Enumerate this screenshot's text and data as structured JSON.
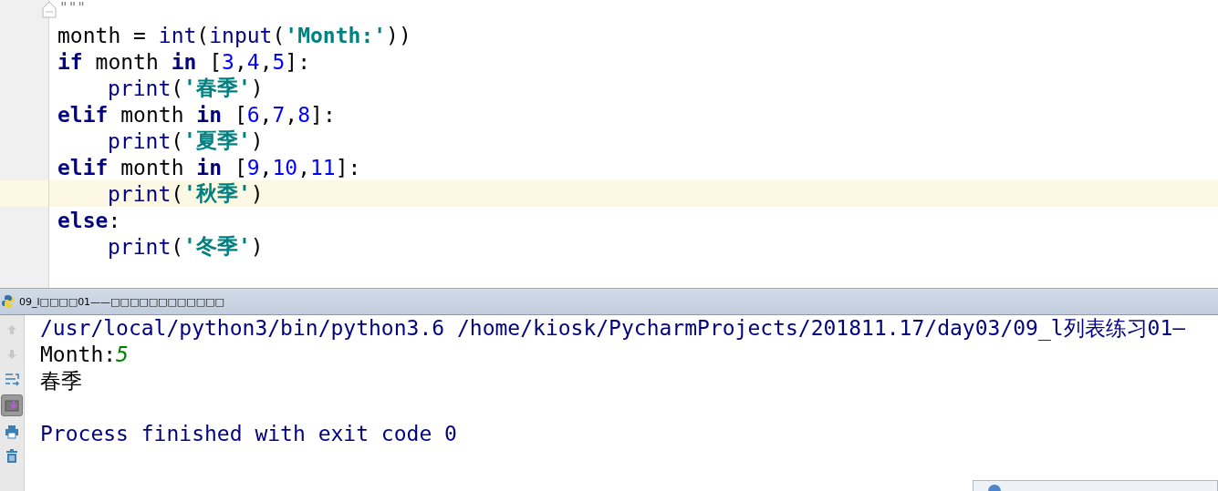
{
  "editor": {
    "code_lines": [
      {
        "current": false,
        "fold": true,
        "tokens": [
          {
            "kind": "docstring",
            "text": "\"\"\""
          }
        ]
      },
      {
        "current": false,
        "fold": false,
        "tokens": [
          {
            "kind": "plain",
            "text": "month = "
          },
          {
            "kind": "builtin",
            "text": "int"
          },
          {
            "kind": "plain",
            "text": "("
          },
          {
            "kind": "builtin",
            "text": "input"
          },
          {
            "kind": "plain",
            "text": "("
          },
          {
            "kind": "string",
            "text": "'Month:'"
          },
          {
            "kind": "plain",
            "text": "))"
          }
        ]
      },
      {
        "current": false,
        "fold": false,
        "tokens": [
          {
            "kind": "keyword",
            "text": "if"
          },
          {
            "kind": "plain",
            "text": " month "
          },
          {
            "kind": "keyword",
            "text": "in"
          },
          {
            "kind": "plain",
            "text": " ["
          },
          {
            "kind": "number",
            "text": "3"
          },
          {
            "kind": "plain",
            "text": ","
          },
          {
            "kind": "number",
            "text": "4"
          },
          {
            "kind": "plain",
            "text": ","
          },
          {
            "kind": "number",
            "text": "5"
          },
          {
            "kind": "plain",
            "text": "]:"
          }
        ]
      },
      {
        "current": false,
        "fold": false,
        "indented": true,
        "tokens": [
          {
            "kind": "builtin",
            "text": "print"
          },
          {
            "kind": "plain",
            "text": "("
          },
          {
            "kind": "string",
            "text": "'春季'"
          },
          {
            "kind": "plain",
            "text": ")"
          }
        ]
      },
      {
        "current": false,
        "fold": false,
        "tokens": [
          {
            "kind": "keyword",
            "text": "elif"
          },
          {
            "kind": "plain",
            "text": " month "
          },
          {
            "kind": "keyword",
            "text": "in"
          },
          {
            "kind": "plain",
            "text": " ["
          },
          {
            "kind": "number",
            "text": "6"
          },
          {
            "kind": "plain",
            "text": ","
          },
          {
            "kind": "number",
            "text": "7"
          },
          {
            "kind": "plain",
            "text": ","
          },
          {
            "kind": "number",
            "text": "8"
          },
          {
            "kind": "plain",
            "text": "]:"
          }
        ]
      },
      {
        "current": false,
        "fold": false,
        "indented": true,
        "tokens": [
          {
            "kind": "builtin",
            "text": "print"
          },
          {
            "kind": "plain",
            "text": "("
          },
          {
            "kind": "string",
            "text": "'夏季'"
          },
          {
            "kind": "plain",
            "text": ")"
          }
        ]
      },
      {
        "current": false,
        "fold": false,
        "tokens": [
          {
            "kind": "keyword",
            "text": "elif"
          },
          {
            "kind": "plain",
            "text": " month "
          },
          {
            "kind": "keyword",
            "text": "in"
          },
          {
            "kind": "plain",
            "text": " ["
          },
          {
            "kind": "number",
            "text": "9"
          },
          {
            "kind": "plain",
            "text": ","
          },
          {
            "kind": "number",
            "text": "10"
          },
          {
            "kind": "plain",
            "text": ","
          },
          {
            "kind": "number",
            "text": "11"
          },
          {
            "kind": "plain",
            "text": "]:"
          }
        ]
      },
      {
        "current": true,
        "fold": false,
        "indented": true,
        "tokens": [
          {
            "kind": "builtin",
            "text": "print"
          },
          {
            "kind": "plain",
            "text": "("
          },
          {
            "kind": "string",
            "text": "'秋季'"
          },
          {
            "kind": "plain",
            "text": ")"
          }
        ]
      },
      {
        "current": false,
        "fold": false,
        "tokens": [
          {
            "kind": "keyword",
            "text": "else"
          },
          {
            "kind": "plain",
            "text": ":"
          }
        ]
      },
      {
        "current": false,
        "fold": false,
        "indented": true,
        "tokens": [
          {
            "kind": "builtin",
            "text": "print"
          },
          {
            "kind": "plain",
            "text": "("
          },
          {
            "kind": "string",
            "text": "'冬季'"
          },
          {
            "kind": "plain",
            "text": ")"
          }
        ]
      }
    ]
  },
  "run_panel": {
    "tab_title": "09_l□□□□01——□□□□□□□□□□□□",
    "toolbar": [
      {
        "kind": "up",
        "on": false
      },
      {
        "kind": "down",
        "on": false
      },
      {
        "kind": "wrap",
        "on": false
      },
      {
        "kind": "scroll_end",
        "on": true
      },
      {
        "kind": "print",
        "on": false
      },
      {
        "kind": "trash",
        "on": false
      }
    ],
    "console_lines": [
      {
        "segments": [
          {
            "kind": "system",
            "text": "/usr/local/python3/bin/python3.6 /home/kiosk/PycharmProjects/201811.17/day03/09_l列表练习01—"
          }
        ]
      },
      {
        "segments": [
          {
            "kind": "output",
            "text": "Month:"
          },
          {
            "kind": "input",
            "text": "5"
          }
        ]
      },
      {
        "segments": [
          {
            "kind": "output",
            "text": "春季"
          }
        ]
      }
    ],
    "exit_message": {
      "segments": [
        {
          "kind": "system",
          "text": "Process finished with exit code 0"
        }
      ]
    }
  },
  "notification": {
    "kind": "info"
  }
}
